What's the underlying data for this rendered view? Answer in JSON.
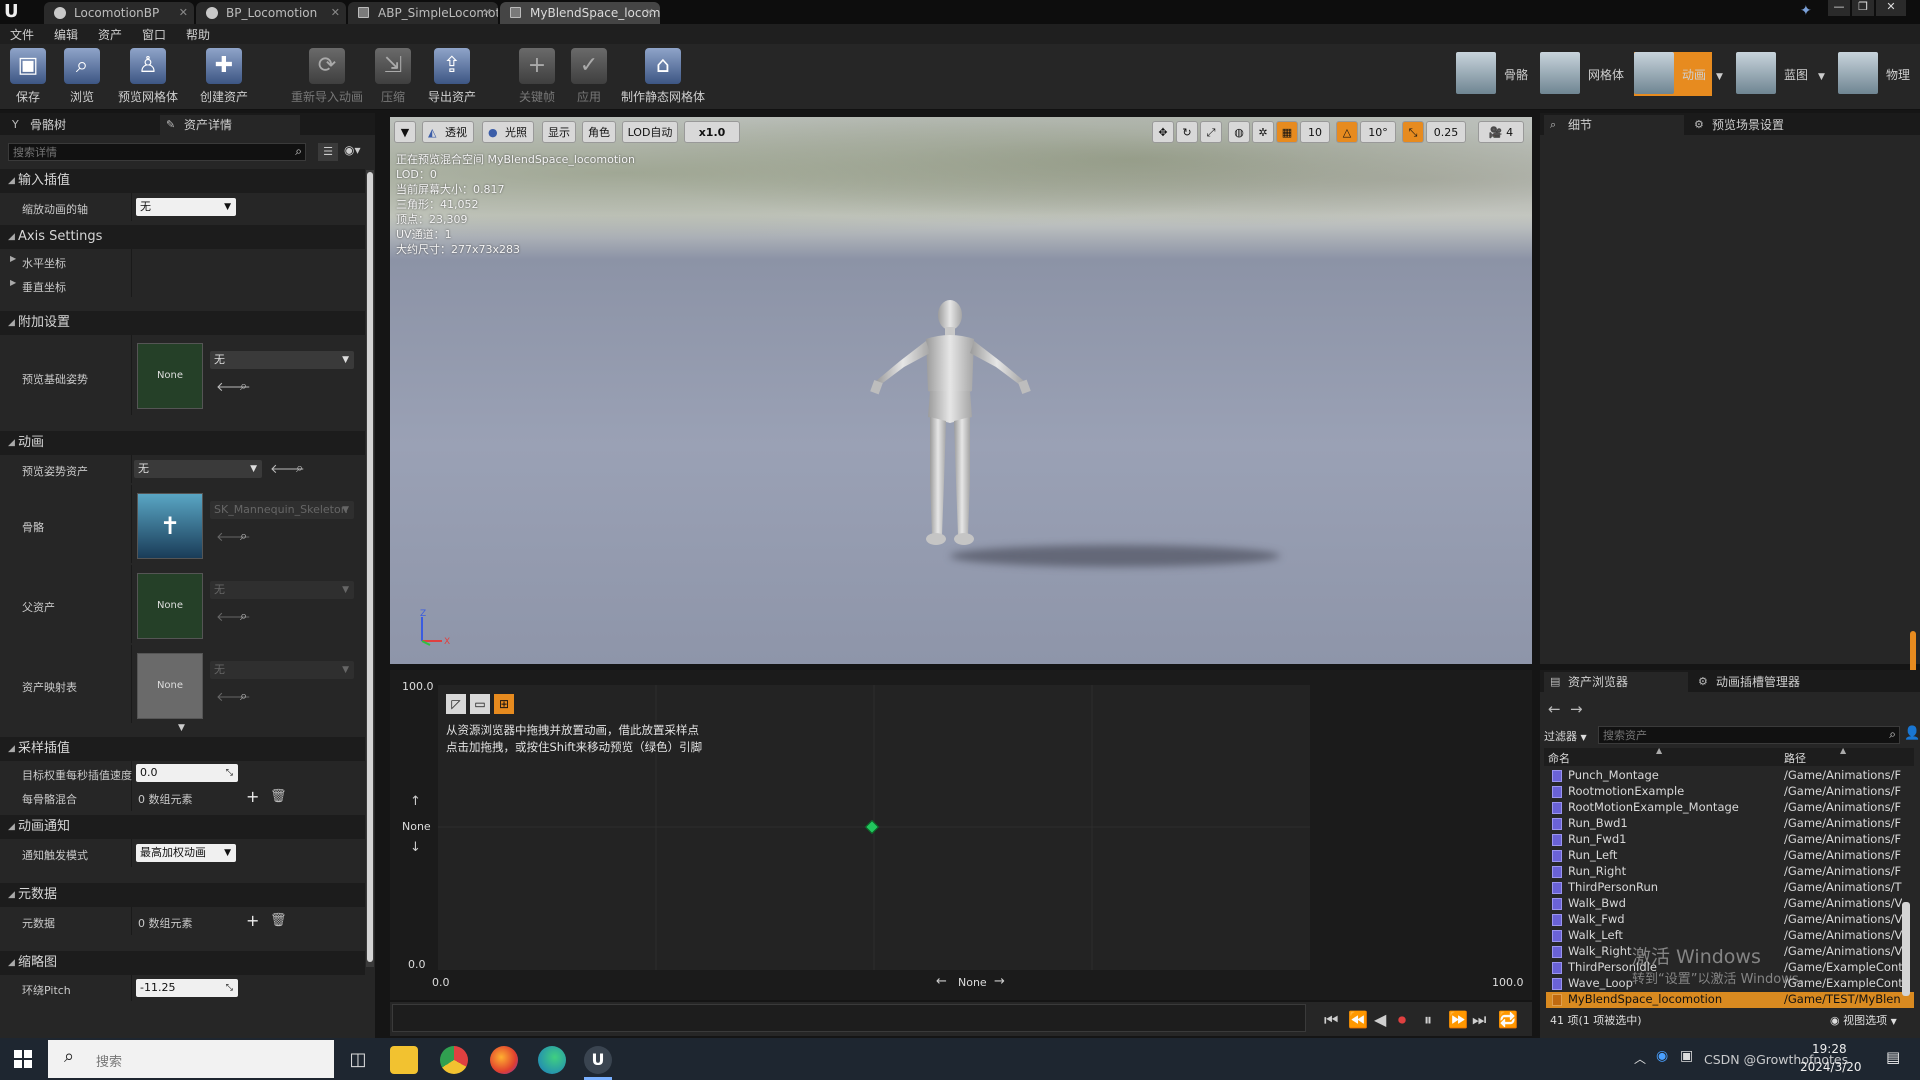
{
  "title_tabs": [
    {
      "label": "LocomotionBP"
    },
    {
      "label": "BP_Locomotion"
    },
    {
      "label": "ABP_SimpleLocomotion"
    },
    {
      "label": "MyBlendSpace_locomotio"
    }
  ],
  "menu": [
    "文件",
    "编辑",
    "资产",
    "窗口",
    "帮助"
  ],
  "toolbar": {
    "save": "保存",
    "browse": "浏览",
    "preview_mesh": "预览网格体",
    "create_asset": "创建资产",
    "reimport": "重新导入动画",
    "compress": "压缩",
    "export": "导出资产",
    "keyframe": "关键帧",
    "apply": "应用",
    "make_static_mesh": "制作静态网格体"
  },
  "modes": [
    "骨骼",
    "网格体",
    "动画",
    "蓝图",
    "物理"
  ],
  "left_tabs": [
    "骨骼树",
    "资产详情"
  ],
  "search_placeholder": "搜索详情",
  "sections": {
    "input_interp": "输入插值",
    "axis_settings": "Axis Settings",
    "additive": "附加设置",
    "animation": "动画",
    "sample_interp": "采样插值",
    "anim_notify": "动画通知",
    "metadata": "元数据",
    "thumbnail": "缩略图"
  },
  "props": {
    "scale_anim_axis": "缩放动画的轴",
    "scale_anim_axis_value": "无",
    "horizontal": "水平坐标",
    "vertical": "垂直坐标",
    "preview_base_pose": "预览基础姿势",
    "preview_base_pose_value": "无",
    "preview_pose_asset": "预览姿势资产",
    "preview_pose_asset_value": "无",
    "skeleton": "骨骼",
    "skeleton_value": "SK_Mannequin_Skeleton",
    "parent_asset": "父资产",
    "parent_asset_value": "无",
    "asset_mapping": "资产映射表",
    "asset_mapping_value": "无",
    "target_weight_speed": "目标权重每秒插值速度",
    "target_weight_speed_value": "0.0",
    "per_bone_blend": "每骨骼混合",
    "per_bone_blend_value": "0 数组元素",
    "notify_trigger_mode": "通知触发模式",
    "notify_trigger_mode_value": "最高加权动画",
    "metadata": "元数据",
    "metadata_value": "0 数组元素",
    "orbit_pitch": "环绕Pitch",
    "orbit_pitch_value": "-11.25",
    "none_thumb": "None"
  },
  "viewport": {
    "perspective": "透视",
    "lit": "光照",
    "show": "显示",
    "character": "角色",
    "lod": "LOD自动",
    "speed": "x1.0",
    "grid": "10",
    "angle": "10°",
    "scale": "0.25",
    "cam_speed": "4",
    "info": [
      "正在预览混合空间 MyBlendSpace_locomotion",
      "LOD：0",
      "当前屏幕大小：0.817",
      "三角形：41,052",
      "顶点：23,309",
      "UV通道：1",
      "大约尺寸：277x73x283"
    ]
  },
  "blend_graph": {
    "y_max": "100.0",
    "y_min": "0.0",
    "x_min": "0.0",
    "x_max": "100.0",
    "y_axis_label": "None",
    "x_axis_label": "None",
    "hint_line1": "从资源浏览器中拖拽并放置动画，借此放置采样点",
    "hint_line2": "点击加拖拽，或按住Shift来移动预览（绿色）引脚"
  },
  "right_tabs": [
    "细节",
    "预览场景设置"
  ],
  "asset_tabs": [
    "资产浏览器",
    "动画插槽管理器"
  ],
  "asset_browser": {
    "filter": "过滤器",
    "search_placeholder": "搜索资产",
    "col_name": "命名",
    "col_path": "路径",
    "rows": [
      {
        "name": "Punch_Montage",
        "path": "/Game/Animations/F"
      },
      {
        "name": "RootmotionExample",
        "path": "/Game/Animations/F"
      },
      {
        "name": "RootMotionExample_Montage",
        "path": "/Game/Animations/F"
      },
      {
        "name": "Run_Bwd1",
        "path": "/Game/Animations/F"
      },
      {
        "name": "Run_Fwd1",
        "path": "/Game/Animations/F"
      },
      {
        "name": "Run_Left",
        "path": "/Game/Animations/F"
      },
      {
        "name": "Run_Right",
        "path": "/Game/Animations/F"
      },
      {
        "name": "ThirdPersonRun",
        "path": "/Game/Animations/T"
      },
      {
        "name": "Walk_Bwd",
        "path": "/Game/Animations/V"
      },
      {
        "name": "Walk_Fwd",
        "path": "/Game/Animations/V"
      },
      {
        "name": "Walk_Left",
        "path": "/Game/Animations/V"
      },
      {
        "name": "Walk_Right",
        "path": "/Game/Animations/V"
      },
      {
        "name": "ThirdPersonIdle",
        "path": "/Game/ExampleCont"
      },
      {
        "name": "Wave_Loop",
        "path": "/Game/ExampleCont"
      },
      {
        "name": "MyBlendSpace_locomotion",
        "path": "/Game/TEST/MyBlen"
      }
    ],
    "status": "41 项(1 项被选中)",
    "view_options": "视图选项"
  },
  "watermark": {
    "line1": "激活 Windows",
    "line2": "转到“设置”以激活 Windows。"
  },
  "taskbar": {
    "search_placeholder": "搜索",
    "time": "19:28",
    "date": "2024/3/20",
    "csdn": "CSDN @Growthofnotes"
  },
  "colors": {
    "accent": "#e78b1f",
    "preview_pin": "#22c55e"
  }
}
